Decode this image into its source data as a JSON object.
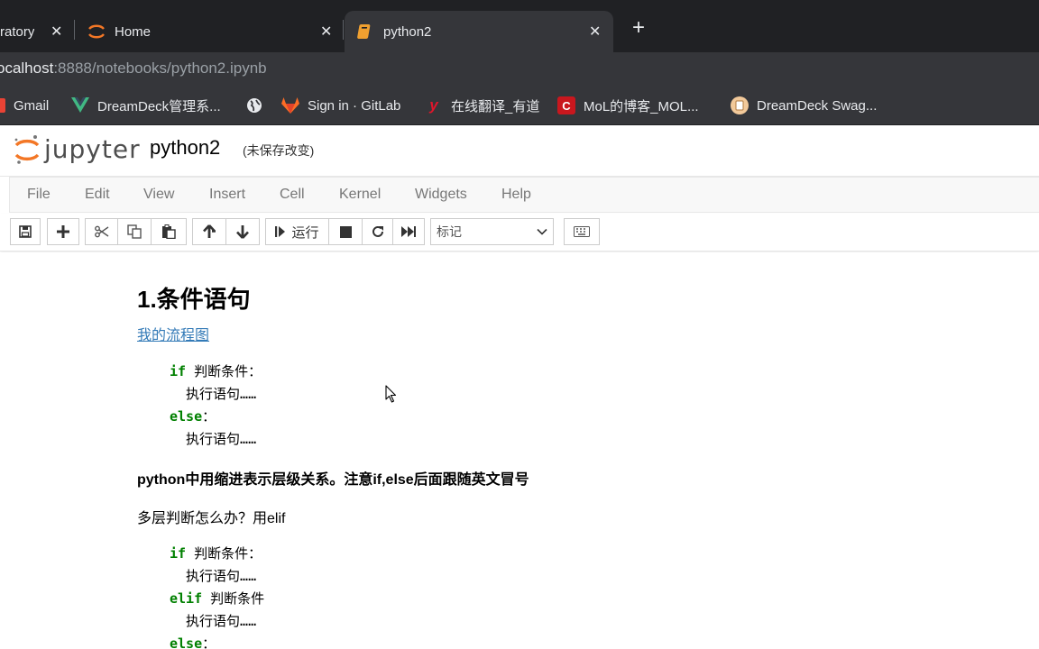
{
  "browser": {
    "tabs": [
      {
        "label": "ratory"
      },
      {
        "label": "Home"
      },
      {
        "label": "python2"
      }
    ],
    "url": {
      "host": "ocalhost",
      "rest": ":8888/notebooks/python2.ipynb"
    },
    "bookmarks": [
      {
        "label": "Gmail",
        "icon": "gmail-icon"
      },
      {
        "label": "DreamDeck管理系...",
        "icon": "vue-icon"
      },
      {
        "label": "",
        "icon": "globe-icon"
      },
      {
        "label": "Sign in · GitLab",
        "icon": "gitlab-icon"
      },
      {
        "label": "在线翻译_有道",
        "icon": "youdao-icon"
      },
      {
        "label": "MoL的博客_MOL...",
        "icon": "csdn-icon"
      },
      {
        "label": "DreamDeck Swag...",
        "icon": "swagger-icon"
      }
    ]
  },
  "jupyter": {
    "logo_text": "jupyter",
    "notebook_name": "python2",
    "save_state": "(未保存改变)",
    "menu": [
      "File",
      "Edit",
      "View",
      "Insert",
      "Cell",
      "Kernel",
      "Widgets",
      "Help"
    ],
    "run_label": "运行",
    "cell_type": "标记"
  },
  "notebook": {
    "heading": "1.条件语句",
    "link": "我的流程图",
    "code1": {
      "line1_kw": "if",
      "line1_rest": " 判断条件：",
      "line2": "  执行语句……",
      "line3_kw": "else",
      "line3_rest": "：",
      "line4": "  执行语句……"
    },
    "bold_note": "python中用缩进表示层级关系。注意if,else后面跟随英文冒号",
    "para": "多层判断怎么办？用elif",
    "code2": {
      "line1_kw": "if",
      "line1_rest": " 判断条件：",
      "line2": "  执行语句……",
      "line3_kw": "elif",
      "line3_rest": " 判断条件",
      "line4": "  执行语句……",
      "line5_kw": "else",
      "line5_rest": "："
    }
  },
  "colors": {
    "chrome_dark": "#202124",
    "chrome_tab": "#35363a",
    "jupyter_orange": "#f37726",
    "keyword_green": "#008000",
    "link_blue": "#337ab7"
  }
}
